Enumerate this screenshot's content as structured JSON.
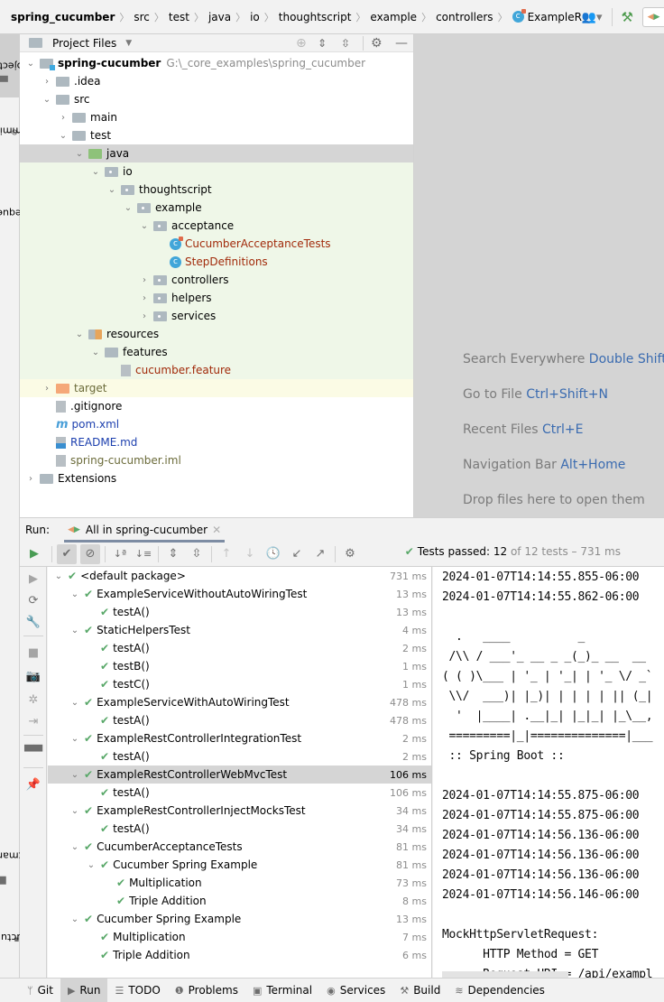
{
  "navbar": {
    "breadcrumbs": [
      "spring_cucumber",
      "src",
      "test",
      "java",
      "io",
      "thoughtscript",
      "example",
      "controllers"
    ],
    "current_file": "ExampleRestControllerWel",
    "icons": [
      "user-icon",
      "build-hammer-icon",
      "run-config-icon"
    ]
  },
  "left_strip": {
    "top_tabs": [
      "Project",
      "Commit",
      "Pull Requests"
    ],
    "bottom_tabs": [
      "Bookmarks",
      "Structure"
    ]
  },
  "project": {
    "header_title": "Project Files",
    "tree": [
      {
        "label": "spring-cucumber",
        "path": "G:\\_core_examples\\spring_cucumber",
        "depth": 0,
        "expanded": true,
        "icon": "module-folder"
      },
      {
        "label": ".idea",
        "depth": 1,
        "expanded": false,
        "icon": "folder"
      },
      {
        "label": "src",
        "depth": 1,
        "expanded": true,
        "icon": "folder"
      },
      {
        "label": "main",
        "depth": 2,
        "expanded": false,
        "icon": "folder"
      },
      {
        "label": "test",
        "depth": 2,
        "expanded": true,
        "icon": "folder"
      },
      {
        "label": "java",
        "depth": 3,
        "expanded": true,
        "icon": "test-source-folder",
        "selected": true
      },
      {
        "label": "io",
        "depth": 4,
        "expanded": true,
        "icon": "package"
      },
      {
        "label": "thoughtscript",
        "depth": 5,
        "expanded": true,
        "icon": "package"
      },
      {
        "label": "example",
        "depth": 6,
        "expanded": true,
        "icon": "package"
      },
      {
        "label": "acceptance",
        "depth": 7,
        "expanded": true,
        "icon": "package"
      },
      {
        "label": "CucumberAcceptanceTests",
        "depth": 8,
        "icon": "test-class"
      },
      {
        "label": "StepDefinitions",
        "depth": 8,
        "icon": "class"
      },
      {
        "label": "controllers",
        "depth": 7,
        "expanded": false,
        "icon": "package"
      },
      {
        "label": "helpers",
        "depth": 7,
        "expanded": false,
        "icon": "package"
      },
      {
        "label": "services",
        "depth": 7,
        "expanded": false,
        "icon": "package"
      },
      {
        "label": "resources",
        "depth": 3,
        "expanded": true,
        "icon": "resources-folder"
      },
      {
        "label": "features",
        "depth": 4,
        "expanded": true,
        "icon": "folder"
      },
      {
        "label": "cucumber.feature",
        "depth": 5,
        "icon": "feature-file"
      },
      {
        "label": "target",
        "depth": 1,
        "expanded": false,
        "icon": "excluded-folder"
      },
      {
        "label": ".gitignore",
        "depth": 1,
        "icon": "gitignore-file"
      },
      {
        "label": "pom.xml",
        "depth": 1,
        "icon": "maven-file"
      },
      {
        "label": "README.md",
        "depth": 1,
        "icon": "markdown-file"
      },
      {
        "label": "spring-cucumber.iml",
        "depth": 1,
        "icon": "iml-file"
      },
      {
        "label": "Extensions",
        "depth": 0,
        "expanded": false,
        "icon": "folder"
      }
    ]
  },
  "editor_hints": [
    {
      "text": "Search Everywhere",
      "key": "Double Shift"
    },
    {
      "text": "Go to File",
      "key": "Ctrl+Shift+N"
    },
    {
      "text": "Recent Files",
      "key": "Ctrl+E"
    },
    {
      "text": "Navigation Bar",
      "key": "Alt+Home"
    },
    {
      "text": "Drop files here to open them",
      "key": ""
    }
  ],
  "run": {
    "label": "Run:",
    "tab_label": "All in spring-cucumber",
    "status": {
      "passed_label": "Tests passed:",
      "passed_count": "12",
      "rest": "of 12 tests – 731 ms"
    },
    "tests": [
      {
        "label": "<default package>",
        "time": "731 ms",
        "depth": 0,
        "expandable": true
      },
      {
        "label": "ExampleServiceWithoutAutoWiringTest",
        "time": "13 ms",
        "depth": 1,
        "expandable": true
      },
      {
        "label": "testA()",
        "time": "13 ms",
        "depth": 2
      },
      {
        "label": "StaticHelpersTest",
        "time": "4 ms",
        "depth": 1,
        "expandable": true
      },
      {
        "label": "testA()",
        "time": "2 ms",
        "depth": 2
      },
      {
        "label": "testB()",
        "time": "1 ms",
        "depth": 2
      },
      {
        "label": "testC()",
        "time": "1 ms",
        "depth": 2
      },
      {
        "label": "ExampleServiceWithAutoWiringTest",
        "time": "478 ms",
        "depth": 1,
        "expandable": true
      },
      {
        "label": "testA()",
        "time": "478 ms",
        "depth": 2
      },
      {
        "label": "ExampleRestControllerIntegrationTest",
        "time": "2 ms",
        "depth": 1,
        "expandable": true
      },
      {
        "label": "testA()",
        "time": "2 ms",
        "depth": 2
      },
      {
        "label": "ExampleRestControllerWebMvcTest",
        "time": "106 ms",
        "depth": 1,
        "expandable": true,
        "selected": true
      },
      {
        "label": "testA()",
        "time": "106 ms",
        "depth": 2
      },
      {
        "label": "ExampleRestControllerInjectMocksTest",
        "time": "34 ms",
        "depth": 1,
        "expandable": true
      },
      {
        "label": "testA()",
        "time": "34 ms",
        "depth": 2
      },
      {
        "label": "CucumberAcceptanceTests",
        "time": "81 ms",
        "depth": 1,
        "expandable": true
      },
      {
        "label": "Cucumber Spring Example",
        "time": "81 ms",
        "depth": 2,
        "expandable": true
      },
      {
        "label": "Multiplication",
        "time": "73 ms",
        "depth": 3
      },
      {
        "label": "Triple Addition",
        "time": "8 ms",
        "depth": 3
      },
      {
        "label": "Cucumber Spring Example",
        "time": "13 ms",
        "depth": 1,
        "expandable": true
      },
      {
        "label": "Multiplication",
        "time": "7 ms",
        "depth": 2
      },
      {
        "label": "Triple Addition",
        "time": "6 ms",
        "depth": 2
      }
    ],
    "console_lines": [
      "2024-01-07T14:14:55.855-06:00",
      "2024-01-07T14:14:55.862-06:00",
      "",
      "  .   ____          _",
      " /\\\\ / ___'_ __ _ _(_)_ __  __",
      "( ( )\\___ | '_ | '_| | '_ \\/ _`",
      " \\\\/  ___)| |_)| | | | | || (_|",
      "  '  |____| .__|_| |_|_| |_\\__,",
      " =========|_|==============|___",
      " :: Spring Boot ::",
      "",
      "2024-01-07T14:14:55.875-06:00",
      "2024-01-07T14:14:55.875-06:00",
      "2024-01-07T14:14:56.136-06:00",
      "2024-01-07T14:14:56.136-06:00",
      "2024-01-07T14:14:56.136-06:00",
      "2024-01-07T14:14:56.146-06:00",
      "",
      "MockHttpServletRequest:",
      "      HTTP Method = GET",
      "      Request URI = /api/exampl"
    ]
  },
  "bottom_bar": {
    "items": [
      {
        "label": "Git",
        "icon": "git-branch-icon"
      },
      {
        "label": "Run",
        "icon": "run-icon",
        "active": true
      },
      {
        "label": "TODO",
        "icon": "todo-list-icon"
      },
      {
        "label": "Problems",
        "icon": "problems-icon"
      },
      {
        "label": "Terminal",
        "icon": "terminal-icon"
      },
      {
        "label": "Services",
        "icon": "services-icon"
      },
      {
        "label": "Build",
        "icon": "build-icon"
      },
      {
        "label": "Dependencies",
        "icon": "dependencies-icon"
      }
    ]
  },
  "colors": {
    "pass_green": "#59a869",
    "selection": "#d5d5d5",
    "test_bg": "#eff7e8",
    "excluded_bg": "#fbfbe5",
    "shortcut_blue": "#3a6bb0"
  }
}
